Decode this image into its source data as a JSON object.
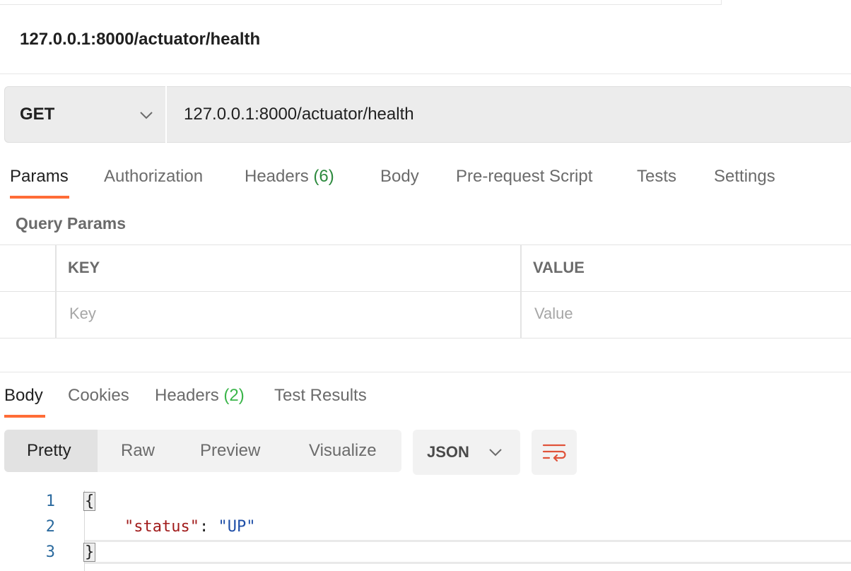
{
  "request": {
    "title": "127.0.0.1:8000/actuator/health",
    "method": "GET",
    "url": "127.0.0.1:8000/actuator/health"
  },
  "request_tabs": [
    {
      "label": "Params"
    },
    {
      "label": "Authorization"
    },
    {
      "label": "Headers",
      "count": "(6)"
    },
    {
      "label": "Body"
    },
    {
      "label": "Pre-request Script"
    },
    {
      "label": "Tests"
    },
    {
      "label": "Settings"
    }
  ],
  "params": {
    "section_label": "Query Params",
    "columns": {
      "key": "KEY",
      "value": "VALUE"
    },
    "placeholders": {
      "key": "Key",
      "value": "Value"
    }
  },
  "response_tabs": [
    {
      "label": "Body"
    },
    {
      "label": "Cookies"
    },
    {
      "label": "Headers",
      "count": "(2)"
    },
    {
      "label": "Test Results"
    }
  ],
  "view_modes": [
    "Pretty",
    "Raw",
    "Preview",
    "Visualize"
  ],
  "format": "JSON",
  "response_body": {
    "line_numbers": [
      "1",
      "2",
      "3"
    ],
    "open_brace": "{",
    "key": "\"status\"",
    "colon": ": ",
    "value": "\"UP\"",
    "close_brace": "}"
  },
  "colors": {
    "accent": "#ff6c37",
    "count_request": "#2d8a3e",
    "count_response": "#3bb54a"
  },
  "icons": [
    "chevron-down-icon",
    "wrap-lines-icon"
  ]
}
